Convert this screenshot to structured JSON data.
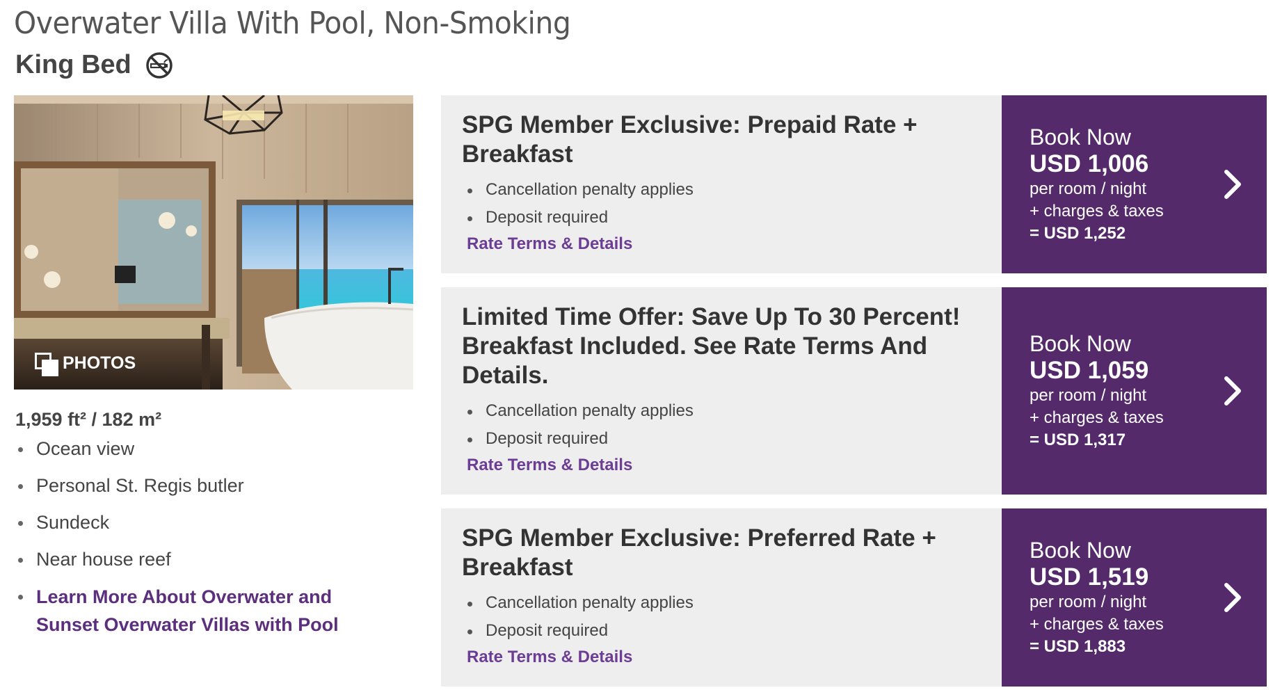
{
  "room": {
    "title": "Overwater Villa With Pool, Non-Smoking",
    "bed_type": "King Bed",
    "photos_label": "PHOTOS",
    "size": "1,959 ft² / 182 m²",
    "amenities": [
      "Ocean view",
      "Personal St. Regis butler",
      "Sundeck",
      "Near house reef"
    ],
    "learn_more": "Learn More About Overwater and Sunset Overwater Villas with Pool"
  },
  "rates": [
    {
      "name": "SPG Member Exclusive: Prepaid Rate + Breakfast",
      "conditions": [
        "Cancellation penalty applies",
        "Deposit required"
      ],
      "terms_link": "Rate Terms & Details",
      "book_label": "Book Now",
      "price": "USD 1,006",
      "per": "per room / night",
      "charges": "+ charges & taxes",
      "total": "= USD 1,252"
    },
    {
      "name": "Limited Time Offer: Save Up To 30 Percent! Breakfast Included. See Rate Terms And Details.",
      "conditions": [
        "Cancellation penalty applies",
        "Deposit required"
      ],
      "terms_link": "Rate Terms & Details",
      "book_label": "Book Now",
      "price": "USD 1,059",
      "per": "per room / night",
      "charges": "+ charges & taxes",
      "total": "= USD 1,317"
    },
    {
      "name": "SPG Member Exclusive: Preferred Rate + Breakfast",
      "conditions": [
        "Cancellation penalty applies",
        "Deposit required"
      ],
      "terms_link": "Rate Terms & Details",
      "book_label": "Book Now",
      "price": "USD 1,519",
      "per": "per room / night",
      "charges": "+ charges & taxes",
      "total": "= USD 1,883"
    }
  ],
  "colors": {
    "brand_purple": "#552a6b",
    "link_purple": "#6c3d94",
    "card_gray": "#eeeeee"
  },
  "icons": {
    "no_smoking": "no-smoking-icon",
    "photos": "photos-icon",
    "book_arrow": "chevron-right-icon"
  }
}
